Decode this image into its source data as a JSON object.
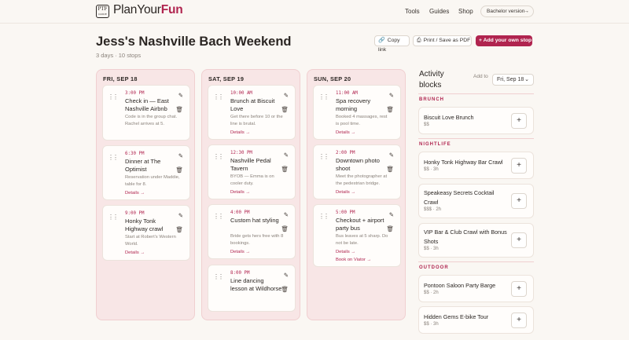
{
  "header": {
    "logo_mark": "PTF",
    "logo_mark_small": "GUIDE",
    "logo_plain": "PlanYour",
    "logo_accent": "Fun",
    "nav": [
      "Tools",
      "Guides",
      "Shop"
    ],
    "version": "Bachelor version"
  },
  "page": {
    "title": "Jess's Nashville Bach Weekend",
    "subtitle": "3 days · 10 stops",
    "copy_link": "Copy link",
    "print": "Print / Save as PDF",
    "add_stop": "Add your own stop"
  },
  "days": [
    {
      "label": "FRI, SEP 18",
      "stops": [
        {
          "time": "3:00 PM",
          "title": "Check in — East Nashville Airbnb",
          "note": "Code is in the group chat. Rachel arrives at 5.",
          "details": ""
        },
        {
          "time": "6:30 PM",
          "title": "Dinner at The Optimist",
          "note": "Reservation under Maddie, table for 8.",
          "details": "Details →"
        },
        {
          "time": "9:00 PM",
          "title": "Honky Tonk Highway crawl",
          "note": "Start at Robert's Western World.",
          "details": "Details →"
        }
      ]
    },
    {
      "label": "SAT, SEP 19",
      "stops": [
        {
          "time": "10:00 AM",
          "title": "Brunch at Biscuit Love",
          "note": "Get there before 10 or the line is brutal.",
          "details": "Details →"
        },
        {
          "time": "12:30 PM",
          "title": "Nashville Pedal Tavern",
          "note": "BYOB — Emma is on cooler duty.",
          "details": "Details →"
        },
        {
          "time": "4:00 PM",
          "title": "Custom hat styling",
          "note": "Bride gets hers free with 8 bookings.",
          "details": "Details →"
        },
        {
          "time": "8:00 PM",
          "title": "Line dancing lesson at Wildhorse",
          "note": "",
          "details": ""
        }
      ]
    },
    {
      "label": "SUN, SEP 20",
      "stops": [
        {
          "time": "11:00 AM",
          "title": "Spa recovery morning",
          "note": "Booked 4 massages, rest is pool time.",
          "details": "Details →"
        },
        {
          "time": "2:00 PM",
          "title": "Downtown photo shoot",
          "note": "Meet the photographer at the pedestrian bridge.",
          "details": "Details →"
        },
        {
          "time": "5:00 PM",
          "title": "Checkout + airport party bus",
          "note": "Bus leaves at 5 sharp. Do not be late.",
          "details": "Details →",
          "extra": "Book on Viator →"
        }
      ]
    }
  ],
  "sidebar": {
    "title": "Activity blocks",
    "add_to": "Add to",
    "day": "Fri, Sep 18",
    "categories": [
      {
        "name": "BRUNCH",
        "items": [
          {
            "name": "Biscuit Love Brunch",
            "meta": "$$"
          }
        ]
      },
      {
        "name": "NIGHTLIFE",
        "items": [
          {
            "name": "Honky Tonk Highway Bar Crawl",
            "meta": "$$ · 3h"
          },
          {
            "name": "Speakeasy Secrets Cocktail Crawl",
            "meta": "$$$ · 2h"
          },
          {
            "name": "VIP Bar & Club Crawl with Bonus Shots",
            "meta": "$$ · 3h"
          }
        ]
      },
      {
        "name": "OUTDOOR",
        "items": [
          {
            "name": "Pontoon Saloon Party Barge",
            "meta": "$$ · 2h"
          },
          {
            "name": "Hidden Gems E-bike Tour",
            "meta": "$$ · 3h"
          }
        ]
      }
    ]
  }
}
